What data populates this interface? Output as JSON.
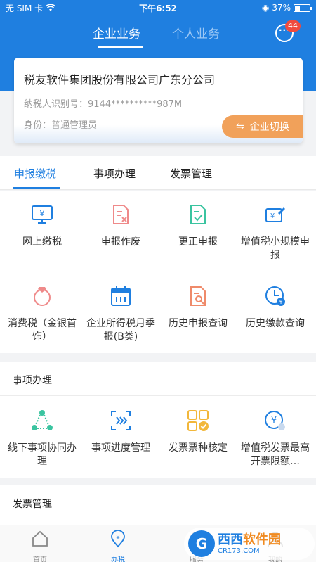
{
  "status_bar": {
    "carrier": "无 SIM 卡",
    "time": "下午6:52",
    "battery": "37%",
    "battery_level": 0.37
  },
  "header": {
    "tabs": [
      {
        "label": "企业业务",
        "active": true
      },
      {
        "label": "个人业务",
        "active": false
      }
    ],
    "message_count": "44"
  },
  "company_card": {
    "name": "税友软件集团股份有限公司广东分公司",
    "taxpayer_id": "纳税人识别号：9144**********987M",
    "role": "身份：普通管理员",
    "switch_button": "企业切换",
    "switch_icon": "⇋"
  },
  "section_tabs": [
    {
      "label": "申报缴税",
      "active": true
    },
    {
      "label": "事项办理",
      "active": false
    },
    {
      "label": "发票管理",
      "active": false
    }
  ],
  "tax_items": [
    {
      "label": "网上缴税",
      "icon": "monitor-yen-icon"
    },
    {
      "label": "申报作废",
      "icon": "document-x-icon"
    },
    {
      "label": "更正申报",
      "icon": "document-check-icon"
    },
    {
      "label": "增值税小规模申报",
      "icon": "card-edit-icon"
    },
    {
      "label": "消费税（金银首饰）",
      "icon": "ring-icon"
    },
    {
      "label": "企业所得税月季报(B类)",
      "icon": "calendar-icon"
    },
    {
      "label": "历史申报查询",
      "icon": "document-search-icon"
    },
    {
      "label": "历史缴款查询",
      "icon": "clock-yen-icon"
    }
  ],
  "matters_section": {
    "title": "事项办理",
    "items": [
      {
        "label": "线下事项协同办理",
        "icon": "network-icon"
      },
      {
        "label": "事项进度管理",
        "icon": "progress-icon"
      },
      {
        "label": "发票票种核定",
        "icon": "grid-check-icon"
      },
      {
        "label": "增值税发票最高开票限额…",
        "icon": "coin-yen-icon"
      }
    ]
  },
  "invoice_section": {
    "title": "发票管理"
  },
  "bottom_nav": [
    {
      "label": "首页",
      "icon": "home-icon",
      "active": false
    },
    {
      "label": "办税",
      "icon": "tax-location-icon",
      "active": true
    },
    {
      "label": "服务",
      "icon": "service-icon",
      "active": false
    },
    {
      "label": "我的",
      "icon": "user-icon",
      "active": false
    }
  ],
  "watermark": {
    "logo_letter": "G",
    "title_a": "西西",
    "title_b": "软件园",
    "url": "CR173.COM"
  },
  "colors": {
    "primary": "#1f7fe0",
    "accent_orange": "#f1a15a",
    "badge_red": "#f04b3e",
    "icon_green": "#3ac4a0",
    "icon_red": "#ef8a8a",
    "icon_yellow": "#f2b73a"
  }
}
